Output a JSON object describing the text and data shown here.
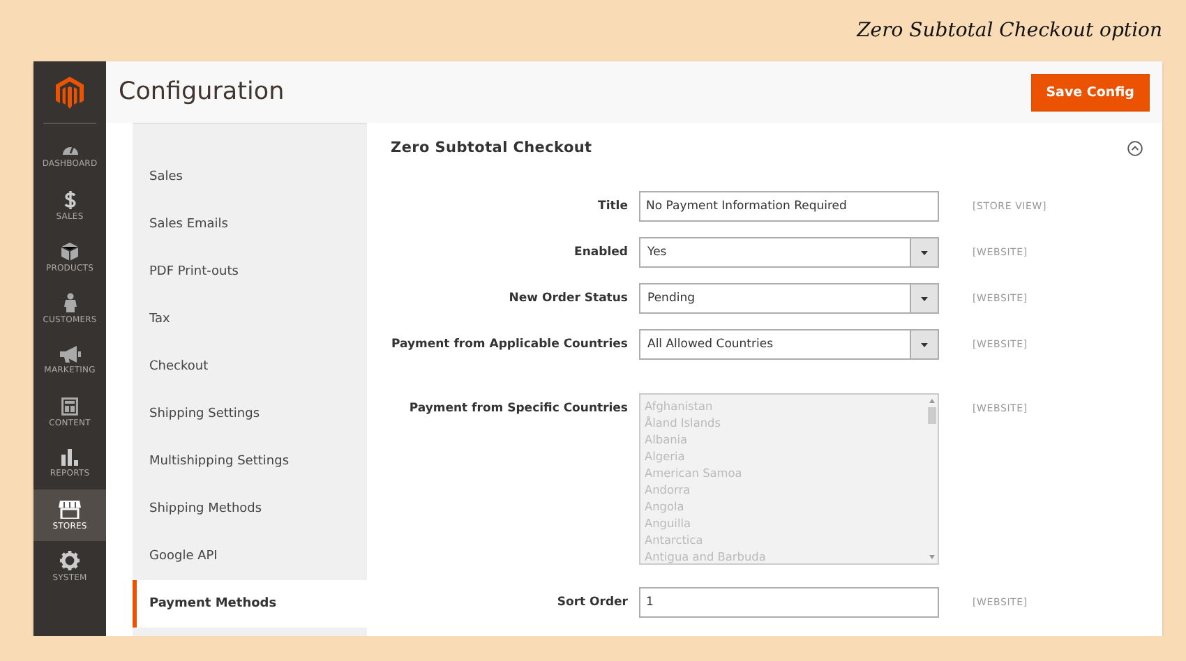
{
  "caption": "Zero Subtotal Checkout option",
  "sidebar": {
    "items": [
      {
        "label": "DASHBOARD",
        "selected": false
      },
      {
        "label": "SALES",
        "selected": false
      },
      {
        "label": "PRODUCTS",
        "selected": false
      },
      {
        "label": "CUSTOMERS",
        "selected": false
      },
      {
        "label": "MARKETING",
        "selected": false
      },
      {
        "label": "CONTENT",
        "selected": false
      },
      {
        "label": "REPORTS",
        "selected": false
      },
      {
        "label": "STORES",
        "selected": true
      },
      {
        "label": "SYSTEM",
        "selected": false
      }
    ]
  },
  "header": {
    "title": "Configuration",
    "save_button": "Save Config"
  },
  "config_nav": {
    "items": [
      {
        "label": "Sales",
        "selected": false
      },
      {
        "label": "Sales Emails",
        "selected": false
      },
      {
        "label": "PDF Print-outs",
        "selected": false
      },
      {
        "label": "Tax",
        "selected": false
      },
      {
        "label": "Checkout",
        "selected": false
      },
      {
        "label": "Shipping Settings",
        "selected": false
      },
      {
        "label": "Multishipping Settings",
        "selected": false
      },
      {
        "label": "Shipping Methods",
        "selected": false
      },
      {
        "label": "Google API",
        "selected": false
      },
      {
        "label": "Payment Methods",
        "selected": true
      }
    ]
  },
  "section": {
    "title": "Zero Subtotal Checkout",
    "expanded": true,
    "fields": [
      {
        "kind": "text",
        "label": "Title",
        "value": "No Payment Information Required",
        "scope": "[STORE VIEW]"
      },
      {
        "kind": "select",
        "label": "Enabled",
        "value": "Yes",
        "scope": "[WEBSITE]"
      },
      {
        "kind": "select",
        "label": "New Order Status",
        "value": "Pending",
        "scope": "[WEBSITE]"
      },
      {
        "kind": "select",
        "label": "Payment from Applicable Countries",
        "value": "All Allowed Countries",
        "scope": "[WEBSITE]"
      },
      {
        "kind": "multiselect",
        "label": "Payment from Specific Countries",
        "disabled": true,
        "options": [
          "Afghanistan",
          "Åland Islands",
          "Albania",
          "Algeria",
          "American Samoa",
          "Andorra",
          "Angola",
          "Anguilla",
          "Antarctica",
          "Antigua and Barbuda"
        ],
        "scope": "[WEBSITE]"
      },
      {
        "kind": "text",
        "label": "Sort Order",
        "value": "1",
        "scope": "[WEBSITE]"
      }
    ]
  }
}
